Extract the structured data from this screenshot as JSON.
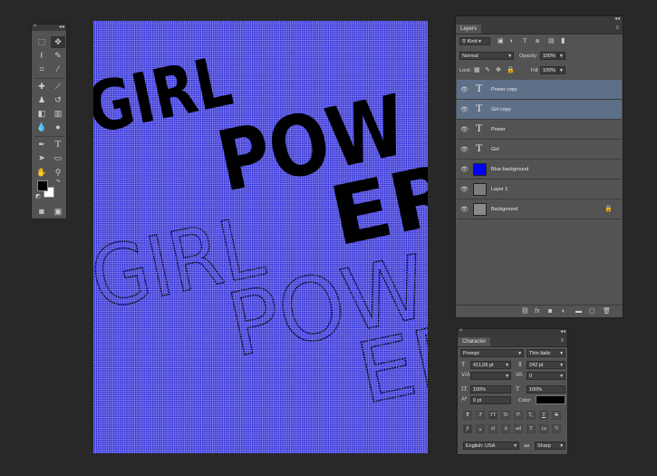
{
  "toolbox": {
    "collapse": "◂◂",
    "close": "×"
  },
  "canvas": {
    "bold_line1": "GIRL",
    "bold_line2": "POW",
    "bold_line3": "ER",
    "outline_line1": "GIRL",
    "outline_line2": "POW",
    "outline_line3": "ER",
    "colors": {
      "background": "#7c79e6",
      "dots": "#1f1fd4",
      "text": "#000000"
    }
  },
  "layers_panel": {
    "tab": "Layers",
    "collapse": "◂◂",
    "close": "×",
    "filter_kind": "Kind",
    "blend_mode": "Normal",
    "opacity_label": "Opacity:",
    "opacity_value": "100%",
    "lock_label": "Lock:",
    "fill_label": "Fill:",
    "fill_value": "100%",
    "layers": [
      {
        "name": "Power copy",
        "type": "text",
        "selected": true
      },
      {
        "name": "Girl copy",
        "type": "text",
        "selected": true
      },
      {
        "name": "Power",
        "type": "text",
        "selected": false
      },
      {
        "name": "Girl",
        "type": "text",
        "selected": false
      },
      {
        "name": "Blue background",
        "type": "fill",
        "color": "#0000ff",
        "selected": false
      },
      {
        "name": "Layer 1",
        "type": "pixel",
        "color": "#7d7d7d",
        "selected": false
      },
      {
        "name": "Background",
        "type": "pixel",
        "color": "#8a8a8a",
        "selected": false,
        "locked": true
      }
    ]
  },
  "character_panel": {
    "tab": "Character",
    "close": "×",
    "collapse": "◂◂",
    "font_family": "Prompt",
    "font_style": "Thin Italic",
    "font_size": "411,06 pt",
    "leading": "242 pt",
    "kerning": "",
    "tracking": "0",
    "vertical_scale": "100%",
    "horizontal_scale": "100%",
    "baseline_shift": "0 pt",
    "color_label": "Color:",
    "text_color": "#000000",
    "type_buttons": [
      "T",
      "T",
      "TT",
      "Tr",
      "T¹",
      "T₁",
      "T",
      "T"
    ],
    "opentype_buttons": [
      "fi",
      "ℴ",
      "st",
      "A",
      "ad",
      "T",
      "1st",
      "½"
    ],
    "language": "English: USA",
    "antialias_icon": "aa",
    "antialias": "Sharp"
  }
}
